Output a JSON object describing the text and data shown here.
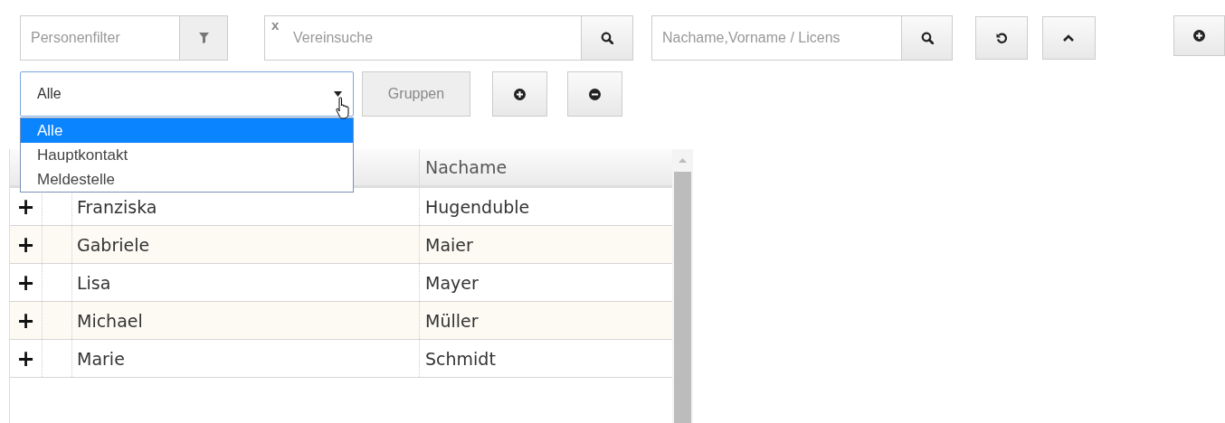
{
  "toolbar": {
    "person_filter": {
      "placeholder": "Personenfilter"
    },
    "club_search": {
      "placeholder": "Vereinsuche",
      "clear": "x"
    },
    "name_search": {
      "placeholder": "Nachame,Vorname / Licens"
    }
  },
  "group_bar": {
    "select": {
      "value": "Alle",
      "expanded": true,
      "options": [
        {
          "label": "Alle",
          "selected": true
        },
        {
          "label": "Hauptkontakt",
          "selected": false
        },
        {
          "label": "Meldestelle",
          "selected": false
        }
      ]
    },
    "groups_button": {
      "label": "Gruppen",
      "disabled": true
    }
  },
  "table": {
    "columns": [
      "Nachame"
    ],
    "rows": [
      {
        "expander": "+",
        "first_name": "Franziska",
        "last_name": "Hugenduble"
      },
      {
        "expander": "+",
        "first_name": "Gabriele",
        "last_name": "Maier"
      },
      {
        "expander": "+",
        "first_name": "Lisa",
        "last_name": "Mayer"
      },
      {
        "expander": "+",
        "first_name": "Michael",
        "last_name": "Müller"
      },
      {
        "expander": "+",
        "first_name": "Marie",
        "last_name": "Schmidt"
      }
    ]
  }
}
